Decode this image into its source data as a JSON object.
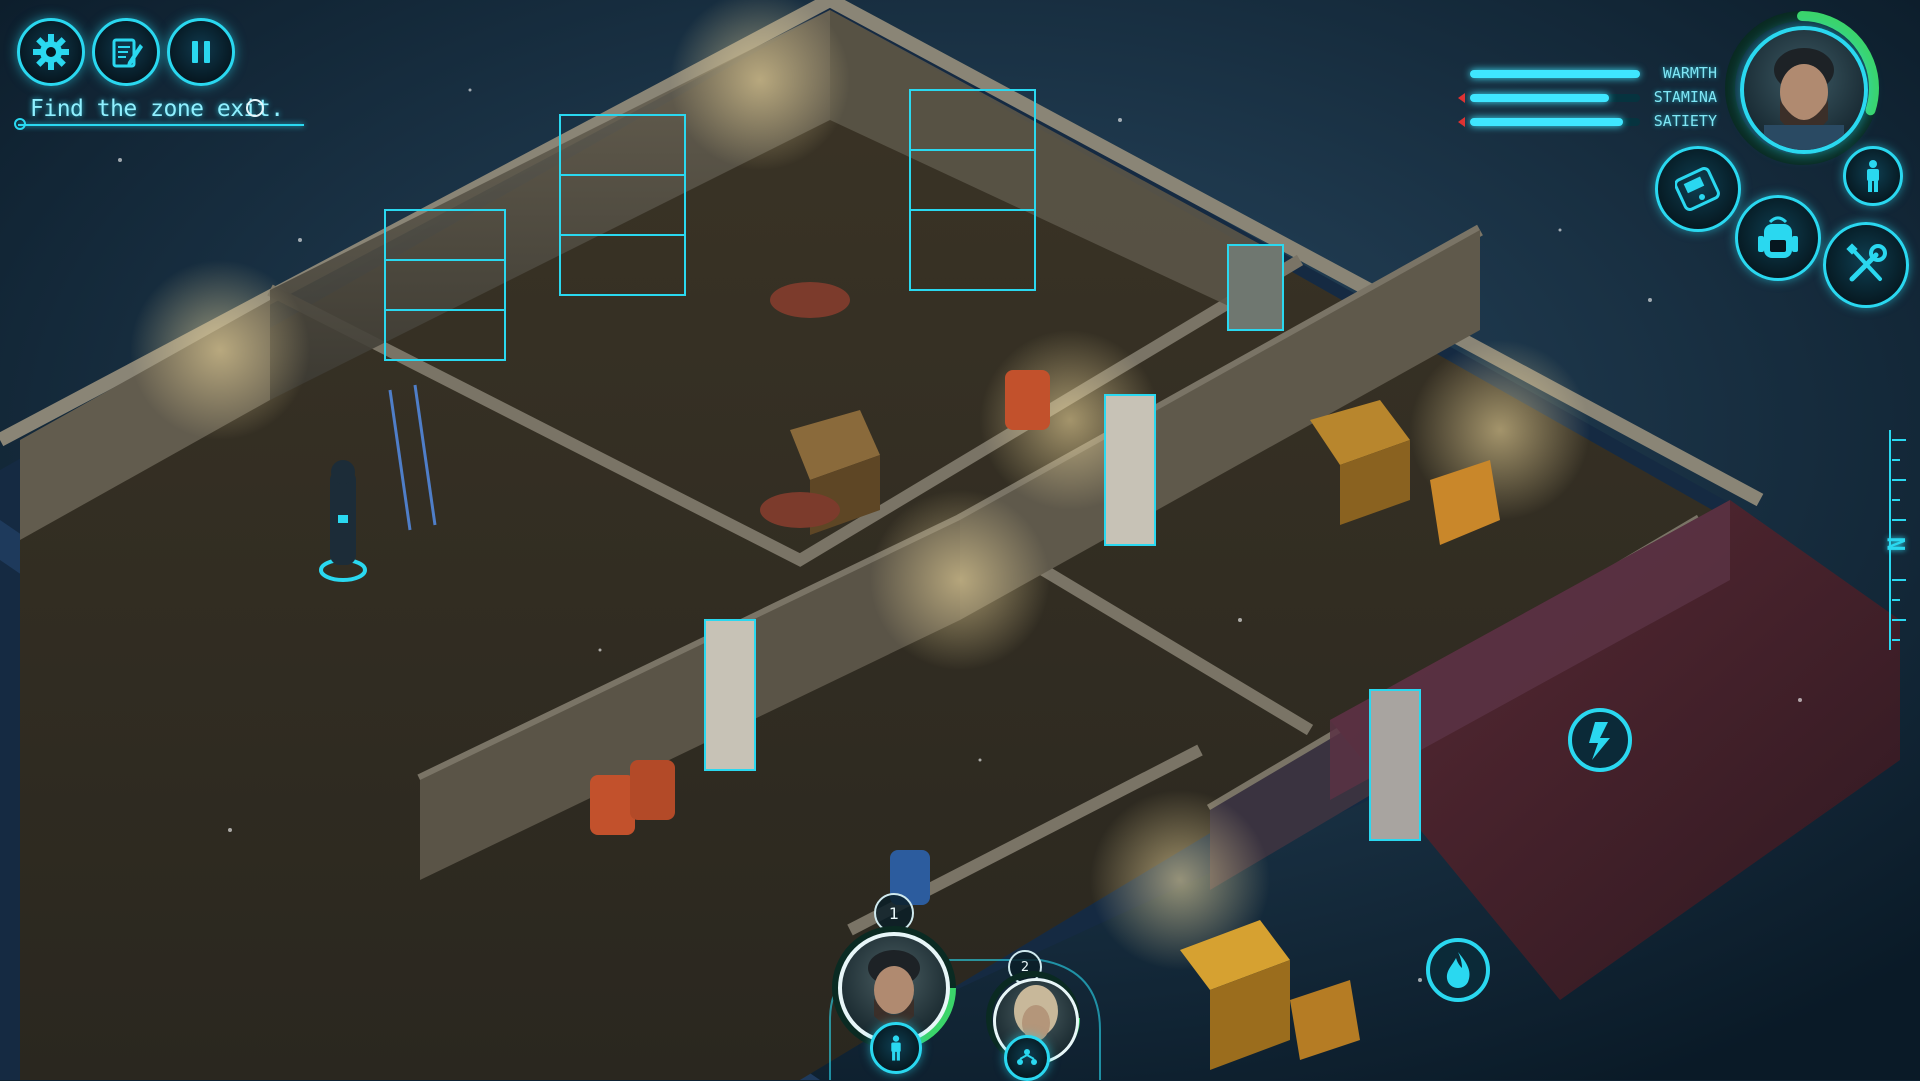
{
  "hud": {
    "buttons": [
      {
        "name": "settings-button",
        "icon": "gear-icon"
      },
      {
        "name": "journal-button",
        "icon": "notepad-icon"
      },
      {
        "name": "pause-button",
        "icon": "pause-icon"
      }
    ],
    "objective": "Find the zone exit."
  },
  "status": {
    "stats": [
      {
        "label": "WARMTH",
        "value": 1.0,
        "warning": false
      },
      {
        "label": "STAMINA",
        "value": 0.82,
        "warning": true
      },
      {
        "label": "SATIETY",
        "value": 0.9,
        "warning": true
      }
    ],
    "health_ring_fraction": 0.3,
    "actions": [
      {
        "name": "pda-button",
        "icon": "handheld-device-icon"
      },
      {
        "name": "inventory-button",
        "icon": "backpack-icon"
      },
      {
        "name": "crafting-button",
        "icon": "wrench-screwdriver-icon"
      },
      {
        "name": "character-stance-button",
        "icon": "person-standing-icon"
      }
    ]
  },
  "compass": {
    "heading": "N"
  },
  "party": [
    {
      "number": "1",
      "icon": "person-standing-icon"
    },
    {
      "number": "2",
      "icon": "group-icon"
    }
  ],
  "world": {
    "interactables": [
      "lightning-generator-icon",
      "fire-icon"
    ]
  },
  "colors": {
    "accent": "#2ad8f0",
    "health": "#3bd46a",
    "warning": "#e03030"
  }
}
